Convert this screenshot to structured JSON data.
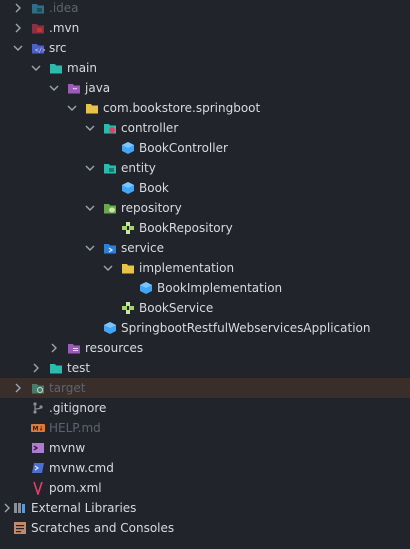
{
  "tree": {
    "items": [
      {
        "label": ".idea",
        "icon": "folder-idea-icon"
      },
      {
        "label": ".mvn",
        "icon": "folder-mvn-icon"
      },
      {
        "label": "src",
        "icon": "folder-src-icon"
      },
      {
        "label": "main",
        "icon": "folder-main-icon"
      },
      {
        "label": "java",
        "icon": "folder-java-icon"
      },
      {
        "label": "com.bookstore.springboot",
        "icon": "package-folder-icon"
      },
      {
        "label": "controller",
        "icon": "folder-controller-icon"
      },
      {
        "label": "BookController",
        "icon": "class-icon"
      },
      {
        "label": "entity",
        "icon": "folder-entity-icon"
      },
      {
        "label": "Book",
        "icon": "class-icon"
      },
      {
        "label": "repository",
        "icon": "folder-repository-icon"
      },
      {
        "label": "BookRepository",
        "icon": "interface-icon"
      },
      {
        "label": "service",
        "icon": "folder-service-icon"
      },
      {
        "label": "implementation",
        "icon": "folder-icon"
      },
      {
        "label": "BookImplementation",
        "icon": "class-icon"
      },
      {
        "label": "BookService",
        "icon": "interface-icon"
      },
      {
        "label": "SpringbootRestfulWebservicesApplication",
        "icon": "class-icon"
      },
      {
        "label": "resources",
        "icon": "folder-resources-icon"
      },
      {
        "label": "test",
        "icon": "folder-test-icon"
      },
      {
        "label": "target",
        "icon": "folder-target-icon"
      },
      {
        "label": ".gitignore",
        "icon": "git-icon"
      },
      {
        "label": "HELP.md",
        "icon": "markdown-icon"
      },
      {
        "label": "mvnw",
        "icon": "shell-script-icon"
      },
      {
        "label": "mvnw.cmd",
        "icon": "powershell-icon"
      },
      {
        "label": "pom.xml",
        "icon": "maven-icon"
      },
      {
        "label": "External Libraries",
        "icon": "libraries-icon"
      },
      {
        "label": "Scratches and Consoles",
        "icon": "scratches-icon"
      }
    ]
  },
  "colors": {
    "background": "#21252b",
    "selected_row": "#3a2e2b",
    "text": "#d7dae0",
    "muted_text": "#5c6370",
    "folder_teal": "#2bbbad",
    "folder_yellow": "#e8c34a",
    "class_blue": "#42a5f5",
    "interface_green": "#a5d66a"
  }
}
